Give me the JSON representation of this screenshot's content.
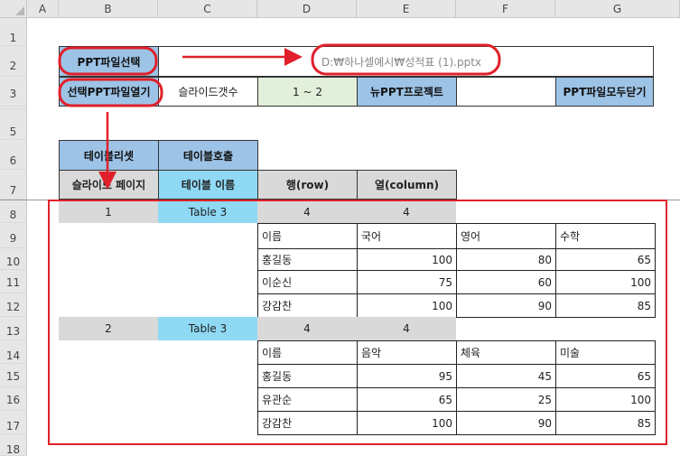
{
  "columns": [
    "A",
    "B",
    "C",
    "D",
    "E",
    "F",
    "G"
  ],
  "rows": [
    "1",
    "2",
    "3",
    "5",
    "6",
    "7",
    "8",
    "9",
    "10",
    "11",
    "12",
    "13",
    "14",
    "15",
    "16",
    "17",
    "18"
  ],
  "buttons": {
    "select_ppt": "PPT파일선택",
    "open_selected": "선택PPT파일열기",
    "new_ppt": "뉴PPT프로젝트",
    "close_all": "PPT파일모두닫기",
    "table_reset": "테이블리셋",
    "table_call": "테이블호출"
  },
  "file_path": "D:₩하나셀예시₩성적표 (1).pptx",
  "slide_count_label": "슬라이드갯수",
  "slide_count_value": "1 ~ 2",
  "headers": {
    "slide_page": "슬라이드 페이지",
    "table_name": "테이블 이름",
    "row": "행(row)",
    "column": "열(column)"
  },
  "entries": [
    {
      "slide": "1",
      "table": "Table 3",
      "rows": "4",
      "cols": "4",
      "grid": [
        [
          "이름",
          "국어",
          "영어",
          "수학"
        ],
        [
          "홍길동",
          "100",
          "80",
          "65"
        ],
        [
          "이순신",
          "75",
          "60",
          "100"
        ],
        [
          "강감찬",
          "100",
          "90",
          "85"
        ]
      ]
    },
    {
      "slide": "2",
      "table": "Table 3",
      "rows": "4",
      "cols": "4",
      "grid": [
        [
          "이름",
          "음악",
          "체육",
          "미술"
        ],
        [
          "홍길동",
          "95",
          "45",
          "65"
        ],
        [
          "유관순",
          "65",
          "25",
          "100"
        ],
        [
          "강감찬",
          "100",
          "90",
          "85"
        ]
      ]
    }
  ],
  "annotation_color": "#e0202a"
}
